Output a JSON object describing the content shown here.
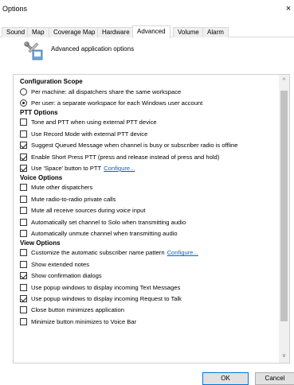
{
  "window": {
    "title": "Options",
    "close_glyph": "×"
  },
  "tabs": [
    {
      "label": "Sound"
    },
    {
      "label": "Map"
    },
    {
      "label": "Coverage Map"
    },
    {
      "label": "Hardware"
    },
    {
      "label": "Advanced",
      "active": true
    },
    {
      "label": "Volume"
    },
    {
      "label": "Alarm"
    }
  ],
  "header": {
    "icon": "tools-settings-icon",
    "text": "Advanced application options"
  },
  "sections": {
    "config": {
      "title": "Configuration Scope",
      "options": [
        {
          "label": "Per machine: all dispatchers share the same workspace",
          "selected": false
        },
        {
          "label": "Per user: a separate workspace for each Windows user account",
          "selected": true
        }
      ]
    },
    "ptt": {
      "title": "PTT Options",
      "items": [
        {
          "label": "Tone and PTT when using external PTT device",
          "checked": false
        },
        {
          "label": "Use Record Mode with external PTT device",
          "checked": false
        },
        {
          "label": "Suggest Queued Message when channel is busy or subscriber radio is offline",
          "checked": true
        },
        {
          "label": "Enable Short Press PTT (press and release instead of press and hold)",
          "checked": true
        },
        {
          "label": "Use 'Space' button to PTT",
          "checked": true,
          "link": "Configure..."
        }
      ]
    },
    "voice": {
      "title": "Voice Options",
      "items": [
        {
          "label": "Mute other dispatchers",
          "checked": false
        },
        {
          "label": "Mute radio-to-radio private calls",
          "checked": false
        },
        {
          "label": "Mute all receive sources during voice input",
          "checked": false
        },
        {
          "label": "Automatically set channel to Solo when transmitting audio",
          "checked": false
        },
        {
          "label": "Automatically unmute channel when transmitting audio",
          "checked": false
        }
      ]
    },
    "view": {
      "title": "View Options",
      "items": [
        {
          "label": "Customize the automatic subscriber name pattern",
          "checked": false,
          "link": "Configure..."
        },
        {
          "label": "Show extended notes",
          "checked": false
        },
        {
          "label": "Show confirmation dialogs",
          "checked": true
        },
        {
          "label": "Use popup windows to display incoming Text Messages",
          "checked": false
        },
        {
          "label": "Use popup windows to display incoming Request to Talk",
          "checked": true
        },
        {
          "label": "Close button minimizes application",
          "checked": false
        },
        {
          "label": "Minimize button minimizes to Voice Bar",
          "checked": false
        }
      ]
    }
  },
  "scroll": {
    "up_glyph": "^",
    "down_glyph": "v"
  },
  "buttons": {
    "ok": "OK",
    "cancel": "Cancel"
  }
}
